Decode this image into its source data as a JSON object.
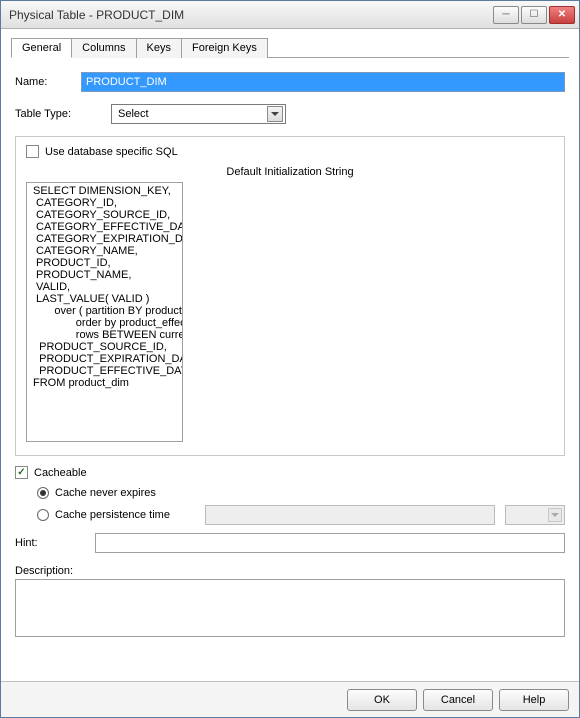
{
  "window": {
    "title": "Physical Table - PRODUCT_DIM"
  },
  "tabs": [
    "General",
    "Columns",
    "Keys",
    "Foreign Keys"
  ],
  "labels": {
    "name": "Name:",
    "tableType": "Table Type:",
    "useDbSql": "Use database specific SQL",
    "initString": "Default Initialization String",
    "cacheable": "Cacheable",
    "cacheNever": "Cache never expires",
    "cachePersist": "Cache persistence time",
    "hint": "Hint:",
    "description": "Description:"
  },
  "values": {
    "name": "PRODUCT_DIM",
    "tableType": "Select",
    "sql": "SELECT DIMENSION_KEY,\n CATEGORY_ID,\n CATEGORY_SOURCE_ID,\n CATEGORY_EFFECTIVE_DATE,\n CATEGORY_EXPIRATION_DATE,\n CATEGORY_NAME,\n PRODUCT_ID,\n PRODUCT_NAME,\n VALID,\n LAST_VALUE( VALID )\n       over ( partition BY product_source_id\n              order by product_effective_date\n              rows BETWEEN current row AND unbounded following ) CURRENT_VALID,\n  PRODUCT_SOURCE_ID,\n  PRODUCT_EXPIRATION_DATE,\n  PRODUCT_EFFECTIVE_DATE\nFROM product_dim",
    "hint": "",
    "description": ""
  },
  "buttons": {
    "ok": "OK",
    "cancel": "Cancel",
    "help": "Help"
  }
}
